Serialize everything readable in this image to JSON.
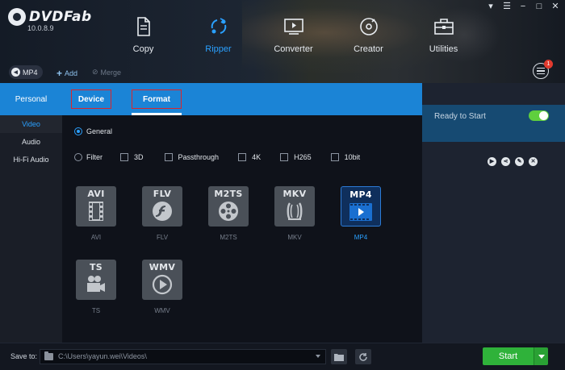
{
  "app": {
    "logo_text": "DVDFab",
    "version": "10.0.8.9",
    "window_controls": [
      {
        "name": "skin-icon",
        "glyph": "▾"
      },
      {
        "name": "menu-icon",
        "glyph": "☰"
      },
      {
        "name": "minimize-icon",
        "glyph": "−"
      },
      {
        "name": "maximize-icon",
        "glyph": "□"
      },
      {
        "name": "close-icon",
        "glyph": "✕"
      }
    ]
  },
  "nav": {
    "items": [
      {
        "label": "Copy",
        "icon": "copy-icon",
        "active": false
      },
      {
        "label": "Ripper",
        "icon": "ripper-icon",
        "active": true
      },
      {
        "label": "Converter",
        "icon": "converter-icon",
        "active": false
      },
      {
        "label": "Creator",
        "icon": "creator-icon",
        "active": false
      },
      {
        "label": "Utilities",
        "icon": "utilities-icon",
        "active": false
      }
    ]
  },
  "toolbar": {
    "profile_label": "MP4",
    "add_label": "Add",
    "merge_label": "Merge",
    "task_badge": "1"
  },
  "task": {
    "status": "Ready to Start"
  },
  "profile_panel": {
    "personal_label": "Personal",
    "tabs": [
      {
        "label": "Device",
        "active": false
      },
      {
        "label": "Format",
        "active": true
      }
    ],
    "side_items": [
      {
        "label": "Video",
        "active": true
      },
      {
        "label": "Audio",
        "active": false
      },
      {
        "label": "Hi-Fi Audio",
        "active": false
      }
    ],
    "general_label": "General",
    "filter_label": "Filter",
    "filters": [
      "3D",
      "Passthrough",
      "4K",
      "H265",
      "10bit"
    ],
    "formats": [
      {
        "label": "AVI",
        "card_text": "AVI",
        "icon": "film-strip-icon",
        "selected": false
      },
      {
        "label": "FLV",
        "card_text": "FLV",
        "icon": "flash-icon",
        "selected": false
      },
      {
        "label": "M2TS",
        "card_text": "M2TS",
        "icon": "film-reel-icon",
        "selected": false
      },
      {
        "label": "MKV",
        "card_text": "MKV",
        "icon": "matroska-icon",
        "selected": false
      },
      {
        "label": "MP4",
        "card_text": "MP4",
        "icon": "video-player-icon",
        "selected": true
      },
      {
        "label": "TS",
        "card_text": "TS",
        "icon": "camera-icon",
        "selected": false
      },
      {
        "label": "WMV",
        "card_text": "WMV",
        "icon": "play-circle-icon",
        "selected": false
      }
    ]
  },
  "bottom": {
    "save_to_label": "Save to:",
    "path_value": "C:\\Users\\yayun.wei\\Videos\\",
    "start_label": "Start"
  },
  "colors": {
    "accent": "#1b84d6",
    "active_text": "#2aa0ff",
    "start_green": "#2fb23a",
    "highlight_red": "#d9262c"
  }
}
